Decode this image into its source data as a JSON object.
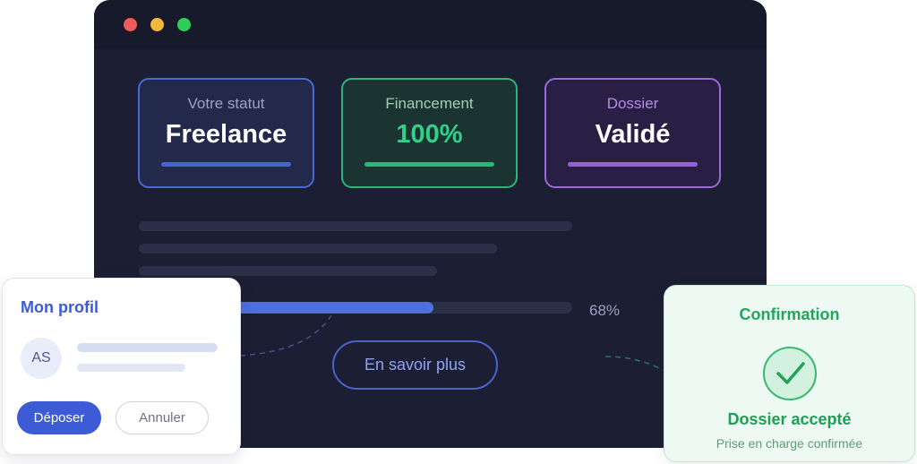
{
  "cards": {
    "statut": {
      "label": "Votre statut",
      "value": "Freelance"
    },
    "financement": {
      "label": "Financement",
      "value": "100%"
    },
    "dossier": {
      "label": "Dossier",
      "value": "Validé"
    }
  },
  "progress": {
    "value_percent": 68,
    "label": "68%"
  },
  "cta": {
    "label": "En savoir plus"
  },
  "profile": {
    "title": "Mon profil",
    "avatar_initials": "AS",
    "deposit_label": "Déposer",
    "cancel_label": "Annuler"
  },
  "confirmation": {
    "title": "Confirmation",
    "icon": "check-icon",
    "main": "Dossier accepté",
    "sub": "Prise en charge confirmée"
  },
  "colors": {
    "window_bg": "#1c1f33",
    "accent_blue": "#3e5bd6",
    "accent_green": "#2ab67c",
    "accent_purple": "#9363d4"
  }
}
